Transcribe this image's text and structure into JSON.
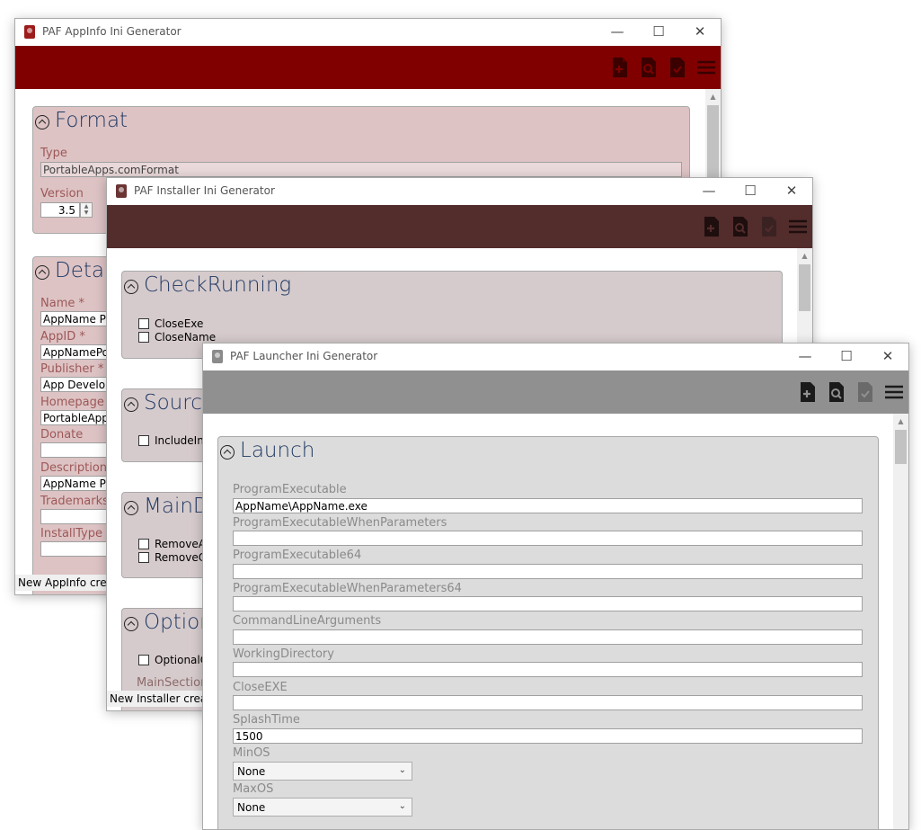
{
  "appinfo": {
    "title": "PAF AppInfo Ini Generator",
    "colors": {
      "toolbar": "#800000",
      "group_bg": "#ddc3c4",
      "label": "#9e5858",
      "icon": "#800000"
    },
    "format": {
      "header": "Format",
      "type_label": "Type",
      "type_value": "PortableApps.comFormat",
      "version_label": "Version",
      "version_value": "3.5"
    },
    "details": {
      "header": "Details",
      "fields": [
        {
          "label": "Name *",
          "value": "AppName Portable"
        },
        {
          "label": "AppID *",
          "value": "AppNamePortable"
        },
        {
          "label": "Publisher *",
          "value": "App Developer"
        },
        {
          "label": "Homepage *",
          "value": "PortableApps.com"
        },
        {
          "label": "Donate",
          "value": ""
        },
        {
          "label": "Description *",
          "value": "AppName Portable"
        },
        {
          "label": "Trademarks",
          "value": ""
        },
        {
          "label": "InstallType",
          "value": ""
        }
      ]
    },
    "status": "New AppInfo created"
  },
  "installer": {
    "title": "PAF Installer Ini Generator",
    "colors": {
      "toolbar": "#532c2c",
      "group_bg": "#d6cbcc",
      "label": "#8c6a6a",
      "icon": "#3b1e1e"
    },
    "groups": {
      "checkrunning": {
        "header": "CheckRunning",
        "items": [
          "CloseExe",
          "CloseName"
        ]
      },
      "source": {
        "header": "Source",
        "items": [
          "IncludeInstallerSource"
        ]
      },
      "maindirectories": {
        "header": "MainDirectories",
        "items": [
          "RemoveAppDirectory",
          "RemoveOtherDirectory"
        ]
      },
      "optionalcomponents": {
        "header": "OptionalComponents",
        "items": [
          "OptionalComponents"
        ],
        "sub_label": "MainSectionTitle"
      }
    },
    "status": "New Installer created"
  },
  "launcher": {
    "title": "PAF Launcher Ini Generator",
    "colors": {
      "toolbar": "#909090",
      "group_bg": "#dcdcdc",
      "label": "#8a8a8a",
      "icon": "#222222"
    },
    "launch": {
      "header": "Launch",
      "fields": [
        {
          "label": "ProgramExecutable",
          "value": "AppName\\AppName.exe"
        },
        {
          "label": "ProgramExecutableWhenParameters",
          "value": ""
        },
        {
          "label": "ProgramExecutable64",
          "value": ""
        },
        {
          "label": "ProgramExecutableWhenParameters64",
          "value": ""
        },
        {
          "label": "CommandLineArguments",
          "value": ""
        },
        {
          "label": "WorkingDirectory",
          "value": ""
        },
        {
          "label": "CloseEXE",
          "value": ""
        },
        {
          "label": "SplashTime",
          "value": "1500"
        }
      ],
      "minos_label": "MinOS",
      "minos_value": "None",
      "maxos_label": "MaxOS",
      "maxos_value": "None"
    }
  },
  "icons": [
    "new-file-icon",
    "search-icon",
    "validate-icon",
    "menu-icon",
    "minimize-icon",
    "maximize-icon",
    "close-icon",
    "collapse-icon"
  ]
}
